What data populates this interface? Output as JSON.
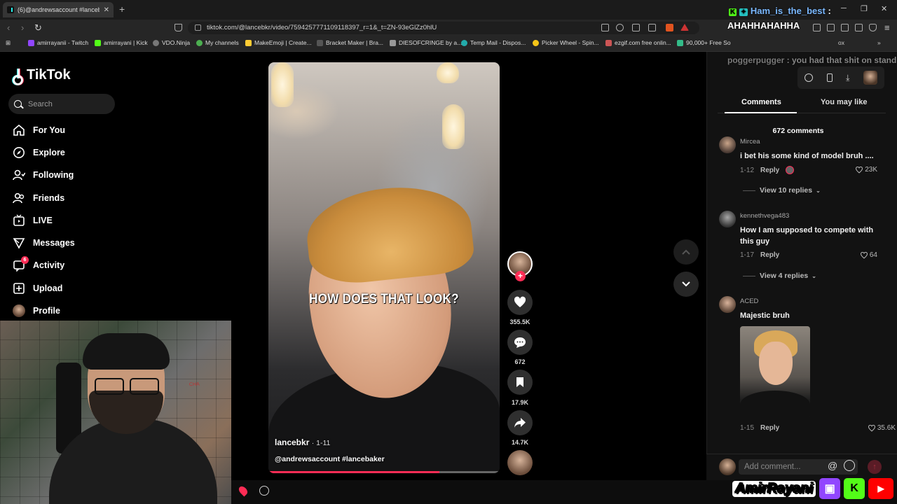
{
  "browser": {
    "tab_title": "(6)@andrewsaccount #lanceb",
    "url": "tiktok.com/@lancebkr/video/7594257771109118397_r=1&_t=ZN-93eGlZz0hlU",
    "bookmarks": [
      "amirrayanii - Twitch",
      "amirrayani | Kick",
      "VDO.Ninja",
      "My channels",
      "MakeEmoji | Create...",
      "Bracket Maker | Bra...",
      "DIESOFCRINGE by a...",
      "Temp Mail - Dispos...",
      "Picker Wheel - Spin...",
      "ezgif.com free onlin...",
      "90,000+ Free So"
    ]
  },
  "chat_overlay": {
    "username": "Ham_is_the_best",
    "message": "AHAHHAHAHHA",
    "username2": "poggerpugger",
    "message2": ": you had that shit on standby",
    "fragment": "ox"
  },
  "sidebar": {
    "logo": "TikTok",
    "search_placeholder": "Search",
    "items": [
      {
        "label": "For You",
        "icon": "home-icon"
      },
      {
        "label": "Explore",
        "icon": "compass-icon"
      },
      {
        "label": "Following",
        "icon": "following-icon"
      },
      {
        "label": "Friends",
        "icon": "friends-icon"
      },
      {
        "label": "LIVE",
        "icon": "live-icon"
      },
      {
        "label": "Messages",
        "icon": "messages-icon"
      },
      {
        "label": "Activity",
        "icon": "activity-icon",
        "badge": "6"
      },
      {
        "label": "Upload",
        "icon": "upload-icon"
      },
      {
        "label": "Profile",
        "icon": "profile-avatar"
      }
    ]
  },
  "webcam": {
    "wall_text": "CHA"
  },
  "video": {
    "caption": "HOW DOES THAT LOOK?",
    "author": "lancebkr",
    "date": "· 1-11",
    "description": "@andrewsaccount #lancebaker",
    "progress": 0.74
  },
  "actions": {
    "likes": "355.5K",
    "comments": "672",
    "saves": "17.9K",
    "shares": "14.7K",
    "follow_plus": "+"
  },
  "panel": {
    "tabs": [
      "Comments",
      "You may like"
    ],
    "comment_count": "672 comments",
    "comments": [
      {
        "user": "Mircea",
        "text": "i bet his some kind of model bruh ....",
        "date": "1-12",
        "reply": "Reply",
        "likes": "23K",
        "view_replies": "View 10 replies"
      },
      {
        "user": "kennethvega483",
        "text": "How I am supposed to compete with this guy",
        "date": "1-17",
        "reply": "Reply",
        "likes": "64",
        "view_replies": "View 4 replies"
      },
      {
        "user": "ACED",
        "text": "Majestic bruh",
        "date": "1-15",
        "reply": "Reply",
        "likes": "35.6K"
      }
    ],
    "add_comment_placeholder": "Add comment...",
    "mention_symbol": "@"
  },
  "branding": {
    "name": "AmirRayani",
    "kick_letter": "K"
  },
  "colors": {
    "accent": "#fe2c55",
    "twitch": "#9146ff",
    "kick": "#53fc18",
    "youtube": "#ff0000"
  }
}
